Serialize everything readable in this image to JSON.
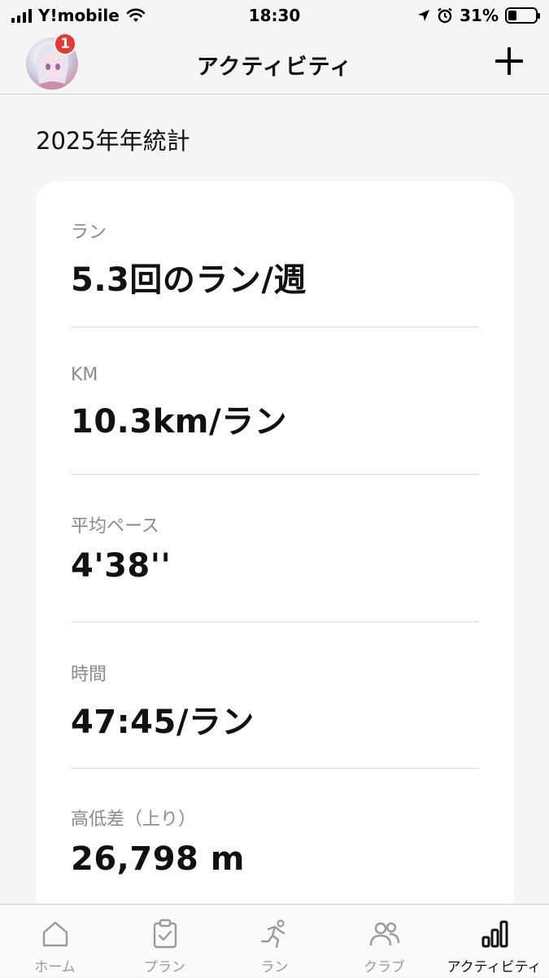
{
  "status_bar": {
    "carrier": "Y!mobile",
    "time": "18:30",
    "battery_percent": "31%",
    "battery_level": 0.31
  },
  "nav": {
    "title": "アクティビティ",
    "notification_count": "1"
  },
  "section_title": "2025年年統計",
  "stats": [
    {
      "label": "ラン",
      "value": "5.3回のラン/週"
    },
    {
      "label": "KM",
      "value": "10.3km/ラン"
    },
    {
      "label": "平均ペース",
      "value": "4'38''"
    },
    {
      "label": "時間",
      "value": "47:45/ラン"
    },
    {
      "label": "高低差（上り）",
      "value": "26,798 m"
    }
  ],
  "tabs": [
    {
      "label": "ホーム",
      "icon": "home-icon"
    },
    {
      "label": "プラン",
      "icon": "clipboard-check-icon"
    },
    {
      "label": "ラン",
      "icon": "runner-icon"
    },
    {
      "label": "クラブ",
      "icon": "people-icon"
    },
    {
      "label": "アクティビティ",
      "icon": "bar-chart-icon",
      "active": true
    }
  ],
  "colors": {
    "badge": "#e53935",
    "background": "#f5f5f5",
    "card": "#ffffff",
    "inactive_tab": "#9a9a9a"
  }
}
